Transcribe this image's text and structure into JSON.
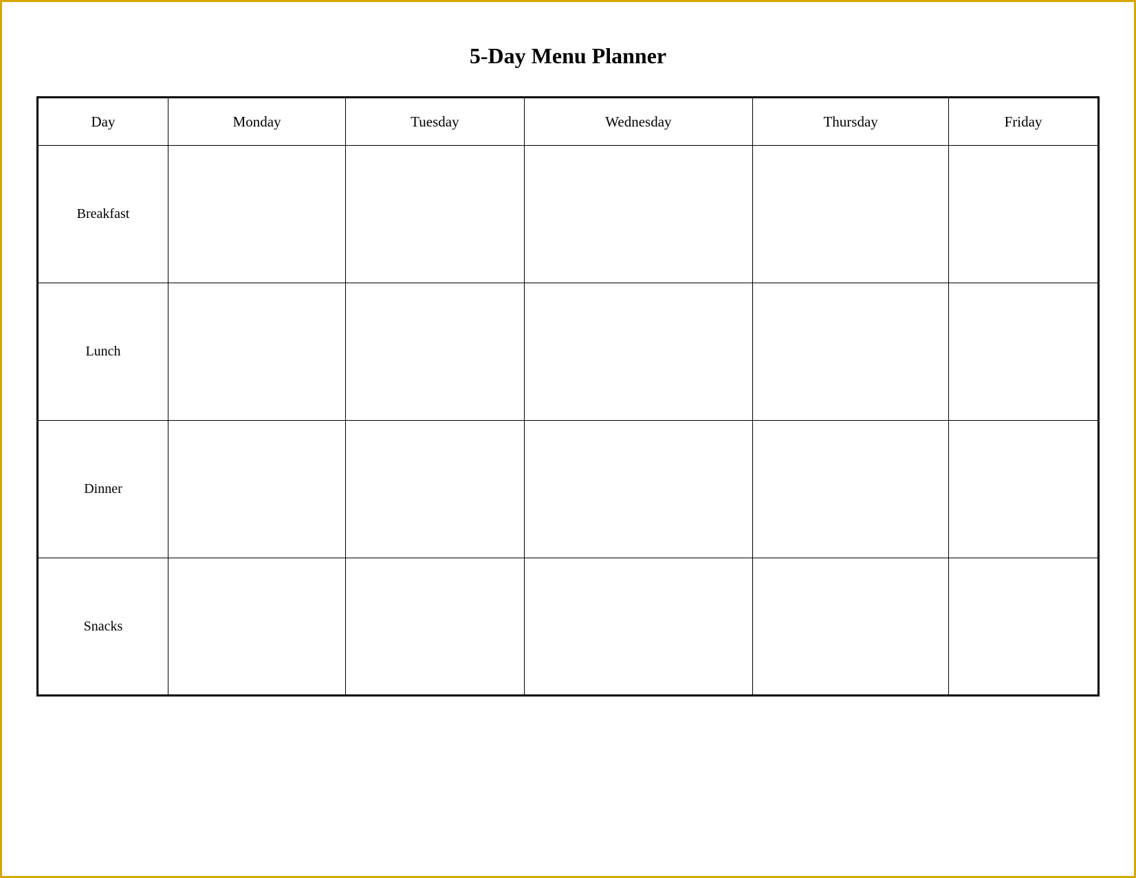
{
  "title": "5-Day Menu Planner",
  "table": {
    "headers": [
      "Day",
      "Monday",
      "Tuesday",
      "Wednesday",
      "Thursday",
      "Friday"
    ],
    "rows": [
      {
        "label": "Breakfast",
        "cells": [
          "",
          "",
          "",
          "",
          ""
        ]
      },
      {
        "label": "Lunch",
        "cells": [
          "",
          "",
          "",
          "",
          ""
        ]
      },
      {
        "label": "Dinner",
        "cells": [
          "",
          "",
          "",
          "",
          ""
        ]
      },
      {
        "label": "Snacks",
        "cells": [
          "",
          "",
          "",
          "",
          ""
        ]
      }
    ]
  }
}
